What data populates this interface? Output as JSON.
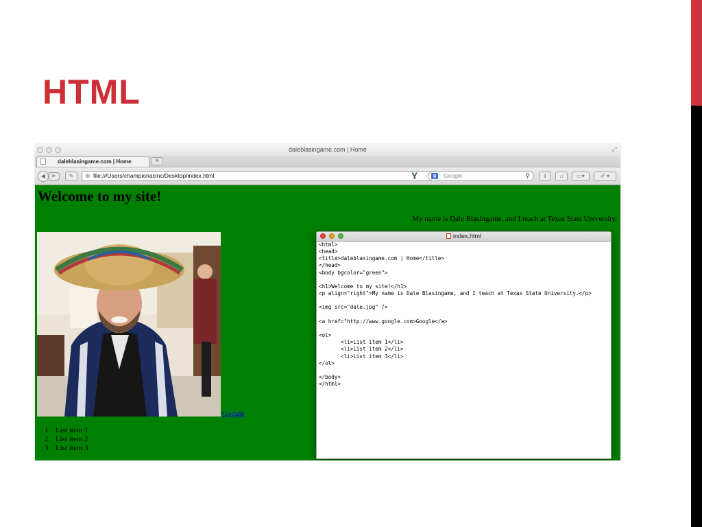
{
  "slide": {
    "title": "HTML",
    "accent_color": "#cc2f35"
  },
  "browser": {
    "window_title": "daleblasingame.com | Home",
    "tab_label": "daleblasingame.com | Home",
    "new_tab_symbol": "+",
    "url": "file:///Users/championacinc/Desktop/index.html",
    "search_placeholder": "Google",
    "search_engine_icon": "google-g-icon"
  },
  "page": {
    "background_color": "#008000",
    "heading": "Welcome to my site!",
    "intro": "My name is Dale Blasingame, and I teach at Texas State University.",
    "link_text": "Google",
    "list_items": [
      "List item 1",
      "List item 2",
      "List item 3"
    ],
    "list_numbers": [
      "1.",
      "2.",
      "3."
    ],
    "photo_alt": "dale.jpg"
  },
  "editor": {
    "file_name": "index.html",
    "code_lines": [
      "<html>",
      "<head>",
      "<title>daleblasingame.com | Home</title>",
      "</head>",
      "<body bgcolor=\"green\">",
      "",
      "<h1>Welcome to my site!</h1>",
      "<p align=\"right\">My name is Dale Blasingame, and I teach at Texas State University.</p>",
      "",
      "<img src=\"dale.jpg\" />",
      "",
      "<a href=\"http://www.google.com>Google</a>",
      "",
      "<ol>",
      "       <li>List item 1</li>",
      "       <li>List item 2</li>",
      "       <li>List item 3</li>",
      "</ol>",
      "",
      "</body>",
      "</html>"
    ]
  }
}
